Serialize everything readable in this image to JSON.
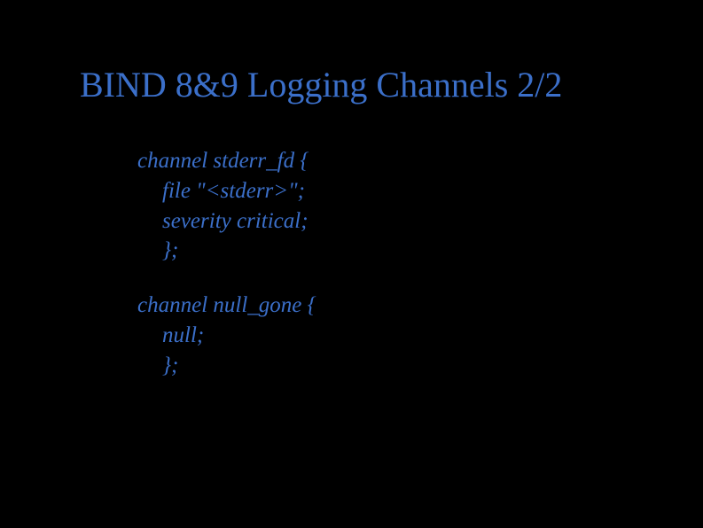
{
  "title": "BIND 8&9 Logging Channels 2/2",
  "blocks": [
    {
      "open": "channel stderr_fd {",
      "lines": [
        "file \"<stderr>\";",
        "severity critical;",
        "};"
      ]
    },
    {
      "open": "channel null_gone {",
      "lines": [
        "null;",
        "};"
      ]
    }
  ]
}
